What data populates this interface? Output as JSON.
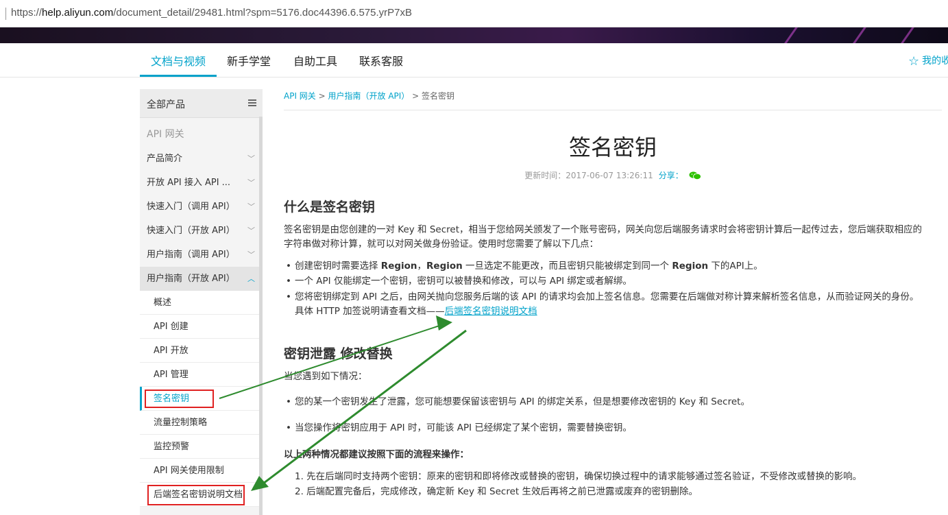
{
  "browser": {
    "url_scheme": "https://",
    "url_host": "help.aliyun.com",
    "url_rest": "/document_detail/29481.html?spm=5176.doc44396.6.575.yrP7xB"
  },
  "nav": {
    "tabs": [
      "文档与视频",
      "新手学堂",
      "自助工具",
      "联系客服"
    ],
    "favorites": "我的收"
  },
  "sidebar": {
    "header": "全部产品",
    "product": "API 网关",
    "items": [
      "产品简介",
      "开放 API 接入 API ...",
      "快速入门（调用 API）",
      "快速入门（开放 API）",
      "用户指南（调用 API）",
      "用户指南（开放 API）"
    ],
    "children": [
      "概述",
      "API 创建",
      "API 开放",
      "API 管理",
      "签名密钥",
      "流量控制策略",
      "监控预警",
      "API 网关使用限制",
      "后端签名密钥说明文档"
    ]
  },
  "breadcrumb": {
    "a": "API 网关",
    "sep1": " > ",
    "b": "用户指南（开放 API）",
    "sep2": " > ",
    "c": "签名密钥"
  },
  "article": {
    "title": "签名密钥",
    "updated": "更新时间：2017-06-07 13:26:11",
    "share": "分享：",
    "h1": "什么是签名密钥",
    "intro1": "签名密钥是由您创建的一对 Key 和 Secret，相当于您给网关颁发了一个账号密码，网关向您后端服务请求时会将密钥计算后一起传过去，您后端获取相应的",
    "intro2": "字符串做对称计算，就可以对网关做身份验证。使用时您需要了解以下几点：",
    "b1_pre": "创建密钥时需要选择 ",
    "b1_r1": "Region",
    "b1_mid": "，",
    "b1_r2": "Region",
    "b1_mid2": " 一旦选定不能更改，而且密钥只能被绑定到同一个 ",
    "b1_r3": "Region",
    "b1_post": " 下的API上。",
    "b2": "一个 API 仅能绑定一个密钥，密钥可以被替换和修改，可以与 API 绑定或者解绑。",
    "b3": "您将密钥绑定到 API 之后，由网关抛向您服务后端的该 API 的请求均会加上签名信息。您需要在后端做对称计算来解析签名信息，从而验证网关的身份。",
    "b3b_pre": "具体 HTTP 加签说明请查看文档——",
    "b3b_link": "后端签名密钥说明文档",
    "h2": "密钥泄露 修改替换",
    "when": "当您遇到如下情况：",
    "c1": "您的某一个密钥发生了泄露，您可能想要保留该密钥与 API 的绑定关系，但是想要修改密钥的 Key 和 Secret。",
    "c2": "当您操作将密钥应用于 API 时，可能该 API 已经绑定了某个密钥，需要替换密钥。",
    "both": "以上两种情况都建议按照下面的流程来操作：",
    "s1": "1. 先在后端同时支持两个密钥：原来的密钥和即将修改或替换的密钥，确保切换过程中的请求能够通过签名验证，不受修改或替换的影响。",
    "s2": "2. 后端配置完备后，完成修改，确定新 Key 和 Secret 生效后再将之前已泄露或废弃的密钥删除。"
  },
  "colors": {
    "accent": "#00a2ca",
    "annotation_red": "#e02020",
    "arrow_green": "#2e8b2e"
  }
}
